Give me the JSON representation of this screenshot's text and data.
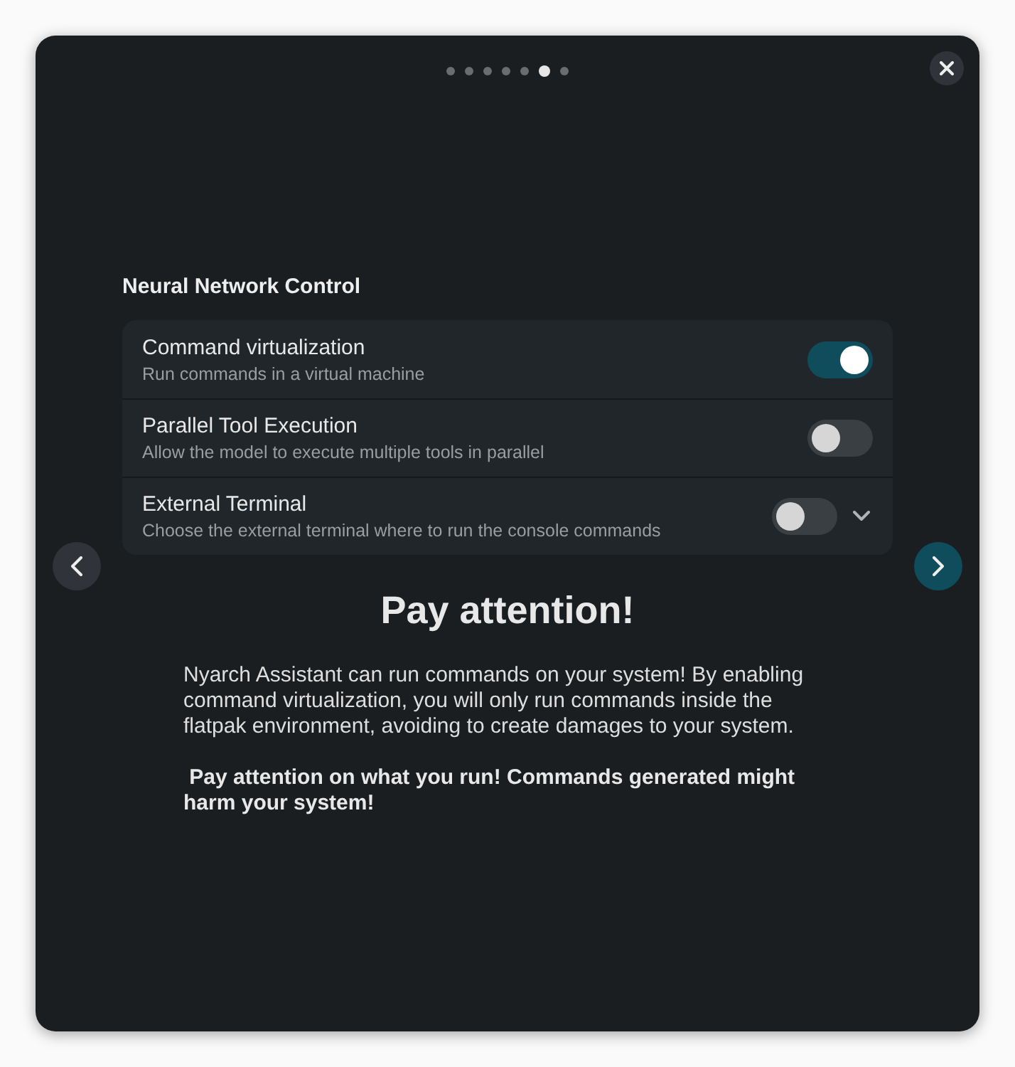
{
  "pager": {
    "pages": [
      {
        "selected": false
      },
      {
        "selected": false
      },
      {
        "selected": false
      },
      {
        "selected": false
      },
      {
        "selected": false
      },
      {
        "selected": true
      },
      {
        "selected": false
      }
    ]
  },
  "section_title": "Neural Network Control",
  "rows": [
    {
      "kind": "switch",
      "title": "Command virtualization",
      "subtitle": "Run commands in a virtual machine",
      "on": true
    },
    {
      "kind": "switch",
      "title": "Parallel Tool Execution",
      "subtitle": "Allow the model to execute multiple tools in parallel",
      "on": false
    },
    {
      "kind": "expander",
      "title": "External Terminal",
      "subtitle": "Choose the external terminal where to run the console commands",
      "on": false,
      "expanded": false
    }
  ],
  "heading": "Pay attention!",
  "paragraphs": [
    {
      "text": "Nyarch Assistant can run commands on your system! By enabling command virtualization, you will only run commands inside the flatpak environment, avoiding to create damages to your system.",
      "bold": false
    },
    {
      "text": " Pay attention on what you run! Commands generated might harm your system!",
      "bold": true
    }
  ]
}
